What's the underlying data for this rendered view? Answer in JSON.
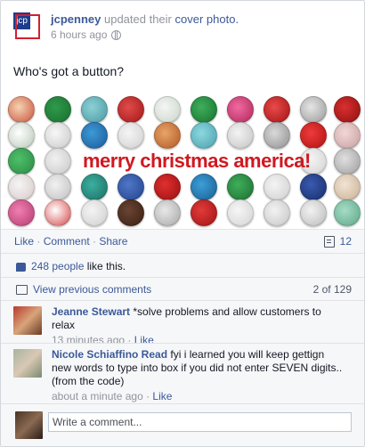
{
  "post": {
    "page_name": "jcpenney",
    "action_text": "updated their",
    "action_link": "cover photo.",
    "timestamp": "6 hours ago",
    "logo_text": "jcp",
    "message": "Who's got a button?",
    "banner_text": "merry christmas america!"
  },
  "actions": {
    "like": "Like",
    "sep1": " · ",
    "comment": "Comment",
    "sep2": " · ",
    "share": "Share",
    "shares_count": "12"
  },
  "likes": {
    "count_link": "248 people",
    "suffix": " like this."
  },
  "comments_nav": {
    "view_previous": "View previous comments",
    "count": "2 of 129"
  },
  "comments": [
    {
      "author": "Jeanne Stewart",
      "text": " *solve problems and allow customers to relax",
      "time": "13 minutes ago",
      "sep": " · ",
      "like": "Like"
    },
    {
      "author": "Nicole Schiaffino Read",
      "text": " fyi i learned you will keep gettign new words to type into box if you did not enter SEVEN digits.. (from the code)",
      "time": "about a minute ago",
      "sep": " · ",
      "like": "Like"
    }
  ],
  "compose": {
    "placeholder": "Write a comment..."
  },
  "colors": {
    "facebook_blue": "#3b5998",
    "banner_red": "#d01820",
    "jcp_blue": "#1d3c8a",
    "jcp_red": "#d3202f"
  }
}
